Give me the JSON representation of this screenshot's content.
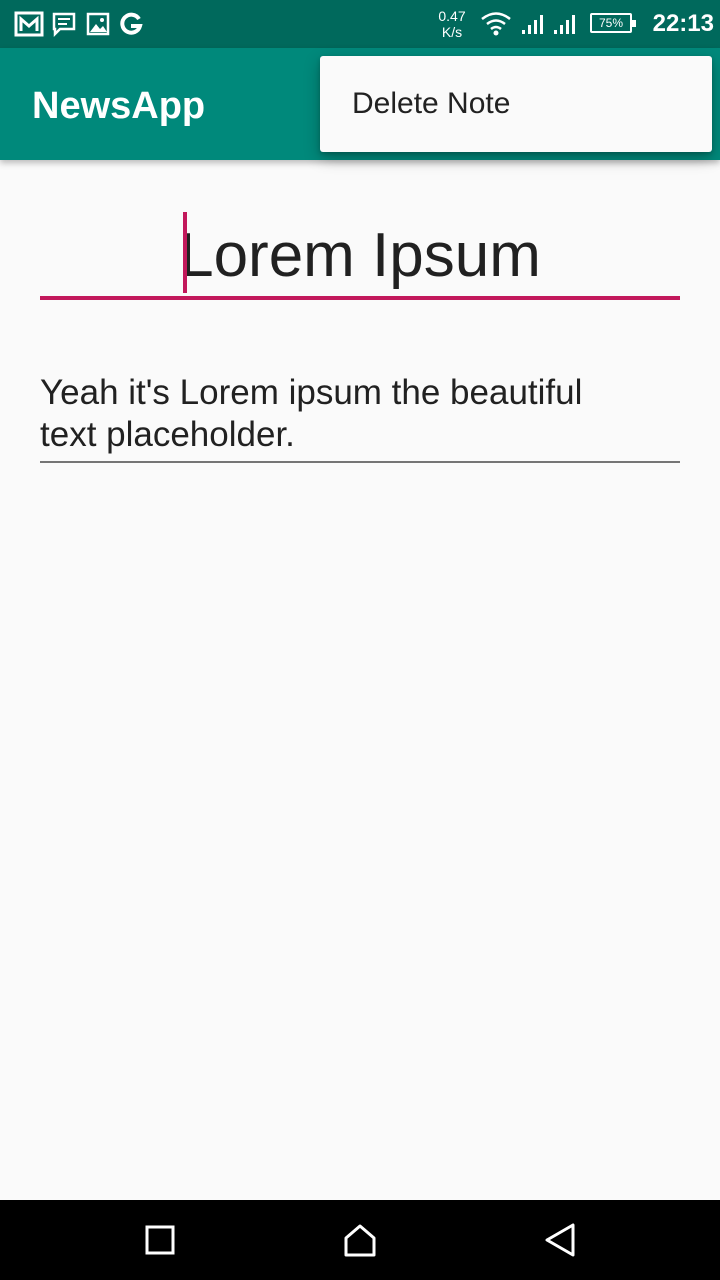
{
  "status_bar": {
    "left_icons": [
      "gmail-icon",
      "message-icon",
      "image-icon",
      "google-icon"
    ],
    "network_speed_value": "0.47",
    "network_speed_unit": "K/s",
    "right_icons": [
      "wifi-icon",
      "signal-icon",
      "signal-icon",
      "battery-icon"
    ],
    "battery_percent": "75%",
    "time": "22:13"
  },
  "app_bar": {
    "title": "NewsApp",
    "background_color": "#00897b"
  },
  "overflow_menu": {
    "items": [
      {
        "label": "Delete Note"
      }
    ]
  },
  "note": {
    "title": "Lorem Ipsum",
    "body": "Yeah it's Lorem ipsum the beautiful text placeholder.",
    "accent_color": "#c2185b"
  },
  "nav_bar": {
    "buttons": [
      "recents-icon",
      "home-icon",
      "back-icon"
    ]
  }
}
